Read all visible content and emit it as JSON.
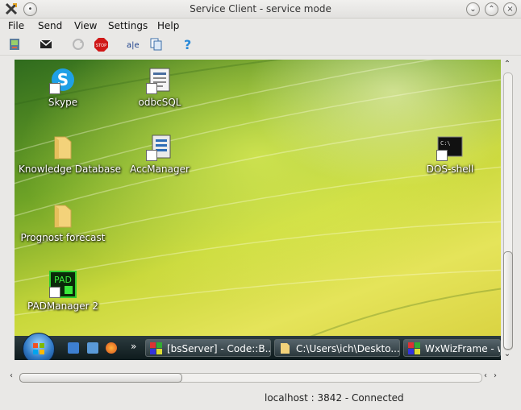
{
  "window": {
    "title": "Service Client - service mode",
    "controls": [
      "minimize-icon",
      "maximize-icon",
      "close-icon"
    ]
  },
  "menu": [
    "File",
    "Send",
    "View",
    "Settings",
    "Help"
  ],
  "toolbar": [
    "connect-icon",
    "message-icon",
    "refresh-icon",
    "stop-icon",
    "text-icon",
    "copy-icon",
    "help-icon"
  ],
  "desktop": {
    "icons": [
      {
        "label": "Skype",
        "icon": "skype-icon"
      },
      {
        "label": "odbcSQL",
        "icon": "document-icon"
      },
      {
        "label": "Knowledge Database",
        "icon": "folder-icon"
      },
      {
        "label": "AccManager",
        "icon": "app-icon"
      },
      {
        "label": "DOS-shell",
        "icon": "console-icon"
      },
      {
        "label": "Prognost forecast",
        "icon": "folder-icon"
      },
      {
        "label": "PADManager 2",
        "icon": "pad-icon"
      }
    ],
    "pad_icon_text": "PAD",
    "console_icon_text": "C:\\",
    "taskbar": {
      "overflow": "»",
      "tasks": [
        {
          "label": "[bsServer] - Code::B..."
        },
        {
          "label": "C:\\Users\\ich\\Deskto..."
        },
        {
          "label": "WxWizFrame - w"
        }
      ]
    }
  },
  "status": {
    "text": "localhost : 3842 - Connected"
  },
  "colors": {
    "accent": "#2f78c4",
    "wallpaper": "#c9d83b",
    "taskbar": "#1a2629"
  }
}
